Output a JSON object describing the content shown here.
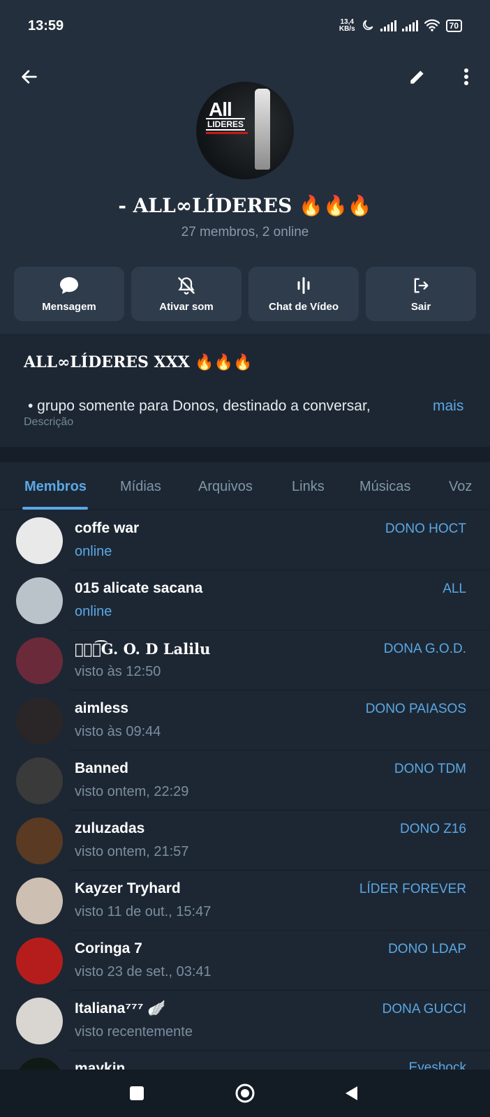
{
  "status_bar": {
    "time": "13:59",
    "net_speed_value": "13,4",
    "net_speed_unit": "KB/s",
    "battery": "70"
  },
  "header": {
    "back_icon": "arrow-left-icon",
    "edit_icon": "pencil-icon",
    "more_icon": "more-vertical-icon",
    "avatar_text": "All",
    "avatar_subtext": "LIDERES",
    "name": "- ALL∞LÍDERES 🔥🔥🔥",
    "status": "27 membros, 2 online"
  },
  "actions": [
    {
      "label": "Mensagem",
      "icon": "chat-bubble-icon"
    },
    {
      "label": "Ativar som",
      "icon": "bell-off-icon"
    },
    {
      "label": "Chat de Vídeo",
      "icon": "audio-wave-icon"
    },
    {
      "label": "Sair",
      "icon": "logout-icon"
    }
  ],
  "description": {
    "title": "ALL∞LÍDERES XXX 🔥🔥🔥",
    "text": "•  grupo somente para Donos, destinado a conversar,",
    "more": "mais",
    "caption": "Descrição"
  },
  "tabs": [
    {
      "label": "Membros",
      "active": true
    },
    {
      "label": "Mídias"
    },
    {
      "label": "Arquivos"
    },
    {
      "label": "Links"
    },
    {
      "label": "Músicas"
    },
    {
      "label": "Voz"
    }
  ],
  "members": [
    {
      "name": "coffe war",
      "seen": "online",
      "role": "DONO HOCT",
      "online": true,
      "avatar_bg": "#e9e9e9"
    },
    {
      "name": "015 alicate sacana",
      "seen": "online",
      "role": "ALL",
      "online": true,
      "avatar_bg": "#b9c3c9"
    },
    {
      "name": "ঔৣ͜͡G. O. D Lalilu",
      "seen": "visto às 12:50",
      "role": "DONA G.O.D.",
      "online": false,
      "avatar_bg": "#6b2a3a"
    },
    {
      "name": "aimless",
      "seen": "visto às 09:44",
      "role": "DONO PAIASOS",
      "online": false,
      "avatar_bg": "#2a2526"
    },
    {
      "name": "Banned",
      "seen": "visto ontem, 22:29",
      "role": "DONO TDM",
      "online": false,
      "avatar_bg": "#3a3a3a"
    },
    {
      "name": "zuluzadas",
      "seen": "visto ontem, 21:57",
      "role": "DONO Z16",
      "online": false,
      "avatar_bg": "#5a3a22"
    },
    {
      "name": "Kayzer Tryhard",
      "seen": "visto 11 de out., 15:47",
      "role": "LÍDER FOREVER",
      "online": false,
      "avatar_bg": "#cdbfb2"
    },
    {
      "name": "Coringa 7",
      "seen": "visto 23 de set., 03:41",
      "role": "DONO LDAP",
      "online": false,
      "avatar_bg": "#b51d1d"
    },
    {
      "name": "Italiana⁷⁷⁷ 🪽",
      "seen": "visto recentemente",
      "role": "DONA GUCCI",
      "online": false,
      "avatar_bg": "#d9d5d0"
    },
    {
      "name": "maykin",
      "seen": "",
      "role": "Eyeshock",
      "online": false,
      "avatar_bg": "#0f1a14"
    }
  ],
  "nav": {
    "recents_icon": "square-icon",
    "home_icon": "circle-home-icon",
    "back_icon": "triangle-back-icon"
  }
}
